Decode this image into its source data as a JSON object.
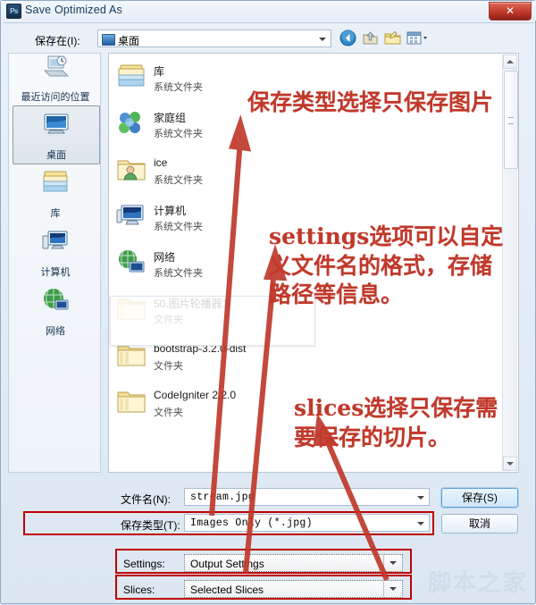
{
  "window": {
    "title": "Save Optimized As",
    "app_icon": "photoshop-icon",
    "close_label": "✕"
  },
  "toolbar": {
    "lookin_label": "保存在(I):",
    "lookin_value": "桌面",
    "icons": [
      "back-icon",
      "up-folder-icon",
      "new-folder-icon",
      "views-icon"
    ]
  },
  "places": [
    {
      "label": "最近访问的位置",
      "icon": "recent-places-icon",
      "selected": false
    },
    {
      "label": "桌面",
      "icon": "desktop-icon",
      "selected": true
    },
    {
      "label": "库",
      "icon": "libraries-icon",
      "selected": false
    },
    {
      "label": "计算机",
      "icon": "computer-icon",
      "selected": false
    },
    {
      "label": "网络",
      "icon": "network-icon",
      "selected": false
    }
  ],
  "files": [
    {
      "name": "库",
      "type": "系统文件夹",
      "icon": "libraries-folder-icon"
    },
    {
      "name": "家庭组",
      "type": "系统文件夹",
      "icon": "homegroup-icon"
    },
    {
      "name": "ice",
      "type": "系统文件夹",
      "icon": "user-folder-icon"
    },
    {
      "name": "计算机",
      "type": "系统文件夹",
      "icon": "computer-icon"
    },
    {
      "name": "网络",
      "type": "系统文件夹",
      "icon": "network-icon"
    },
    {
      "name": "50.图片轮播器1",
      "type": "文件夹",
      "icon": "folder-icon"
    },
    {
      "name": "bootstrap-3.2.0-dist",
      "type": "文件夹",
      "icon": "folder-icon"
    },
    {
      "name": "CodeIgniter 2.2.0",
      "type": "文件夹",
      "icon": "folder-icon"
    }
  ],
  "form": {
    "filename_label": "文件名(N):",
    "filename_value": "stream.jpg",
    "filetype_label": "保存类型(T):",
    "filetype_value": "Images Only (*.jpg)",
    "settings_label": "Settings:",
    "settings_value": "Output Settings",
    "slices_label": "Slices:",
    "slices_value": "Selected Slices",
    "save_button": "保存(S)",
    "cancel_button": "取消"
  },
  "annotations": [
    {
      "text": "保存类型选择只保存图片",
      "color": "#c0392b"
    },
    {
      "text": "settings选项可以自定\n义文件名的格式，存储\n路径等信息。",
      "color": "#c0392b"
    },
    {
      "text": "slices选择只保存需\n要保存的切片。",
      "color": "#c0392b"
    }
  ],
  "watermark": "脚本之家"
}
